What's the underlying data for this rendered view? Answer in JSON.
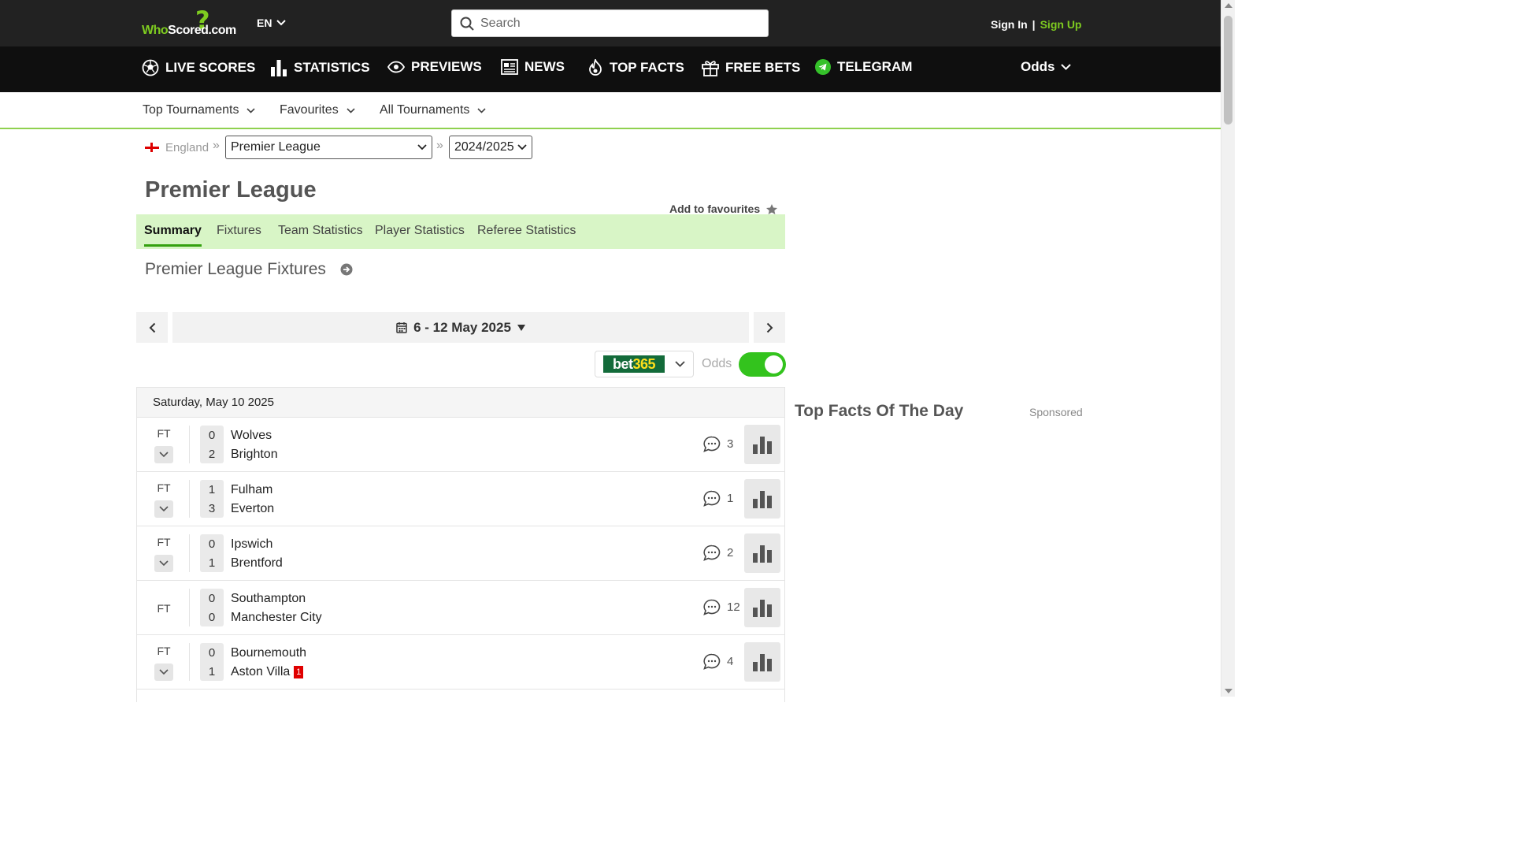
{
  "header": {
    "logo": {
      "who": "Who",
      "scored": "Scored",
      "domain": ".com"
    },
    "language": "EN",
    "search": {
      "placeholder": "Search",
      "value": ""
    },
    "auth": {
      "sign_in": "Sign In",
      "separator": "|",
      "sign_up": "Sign Up"
    }
  },
  "main_nav": {
    "items": [
      {
        "label": "LIVE SCORES",
        "icon": "soccer-ball-icon"
      },
      {
        "label": "STATISTICS",
        "icon": "bar-chart-icon"
      },
      {
        "label": "PREVIEWS",
        "icon": "eye-icon"
      },
      {
        "label": "NEWS",
        "icon": "newspaper-icon"
      },
      {
        "label": "TOP FACTS",
        "icon": "flame-icon"
      },
      {
        "label": "FREE BETS",
        "icon": "gift-icon"
      },
      {
        "label": "TELEGRAM",
        "icon": "telegram-icon"
      }
    ],
    "odds_label": "Odds"
  },
  "sub_nav": {
    "items": [
      "Top Tournaments",
      "Favourites",
      "All Tournaments"
    ]
  },
  "breadcrumb": {
    "country": "England",
    "separator": "»",
    "tournament": "Premier League",
    "season": "2024/2025"
  },
  "page": {
    "title": "Premier League",
    "add_to_favourites": "Add to favourites"
  },
  "tabs": [
    "Summary",
    "Fixtures",
    "Team Statistics",
    "Player Statistics",
    "Referee Statistics"
  ],
  "active_tab": "Summary",
  "fixtures": {
    "title": "Premier League Fixtures",
    "date_range": "6 - 12 May 2025",
    "bookmaker": {
      "part1": "bet",
      "part2": "365"
    },
    "odds_label": "Odds",
    "odds_enabled": true,
    "day": "Saturday, May 10 2025",
    "matches": [
      {
        "status": "FT",
        "expandable": true,
        "home": "Wolves",
        "away": "Brighton",
        "home_score": "0",
        "away_score": "2",
        "comments": "3",
        "away_red": ""
      },
      {
        "status": "FT",
        "expandable": true,
        "home": "Fulham",
        "away": "Everton",
        "home_score": "1",
        "away_score": "3",
        "comments": "1",
        "away_red": ""
      },
      {
        "status": "FT",
        "expandable": true,
        "home": "Ipswich",
        "away": "Brentford",
        "home_score": "0",
        "away_score": "1",
        "comments": "2",
        "away_red": ""
      },
      {
        "status": "FT",
        "expandable": false,
        "home": "Southampton",
        "away": "Manchester City",
        "home_score": "0",
        "away_score": "0",
        "comments": "12",
        "away_red": ""
      },
      {
        "status": "FT",
        "expandable": true,
        "home": "Bournemouth",
        "away": "Aston Villa",
        "home_score": "0",
        "away_score": "1",
        "comments": "4",
        "away_red": "1"
      }
    ]
  },
  "sidebar": {
    "top_facts_title": "Top Facts Of The Day",
    "sponsored": "Sponsored"
  },
  "colors": {
    "brand_green": "#7ecb20",
    "tab_bar_bg": "#d8f5c6",
    "toggle_on": "#33c31d",
    "red_card": "#e00000"
  }
}
